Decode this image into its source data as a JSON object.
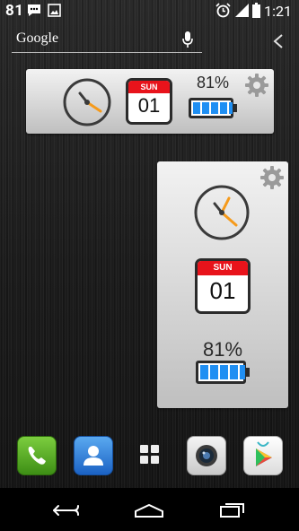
{
  "status_bar": {
    "notification_count": "81",
    "time": "1:21"
  },
  "search": {
    "placeholder": "Google"
  },
  "widget_small": {
    "day_name": "SUN",
    "day_number": "01",
    "battery_percent": "81%",
    "battery_level": 0.81
  },
  "widget_large": {
    "day_name": "SUN",
    "day_number": "01",
    "battery_percent": "81%",
    "battery_level": 0.81
  },
  "dock": [
    "phone-icon",
    "contacts-icon",
    "app-drawer-icon",
    "camera-icon",
    "play-store-icon"
  ],
  "colors": {
    "calendar_red": "#e8131b",
    "battery_blue": "#1f8ff3",
    "clock_hand_orange": "#f59a1b"
  }
}
